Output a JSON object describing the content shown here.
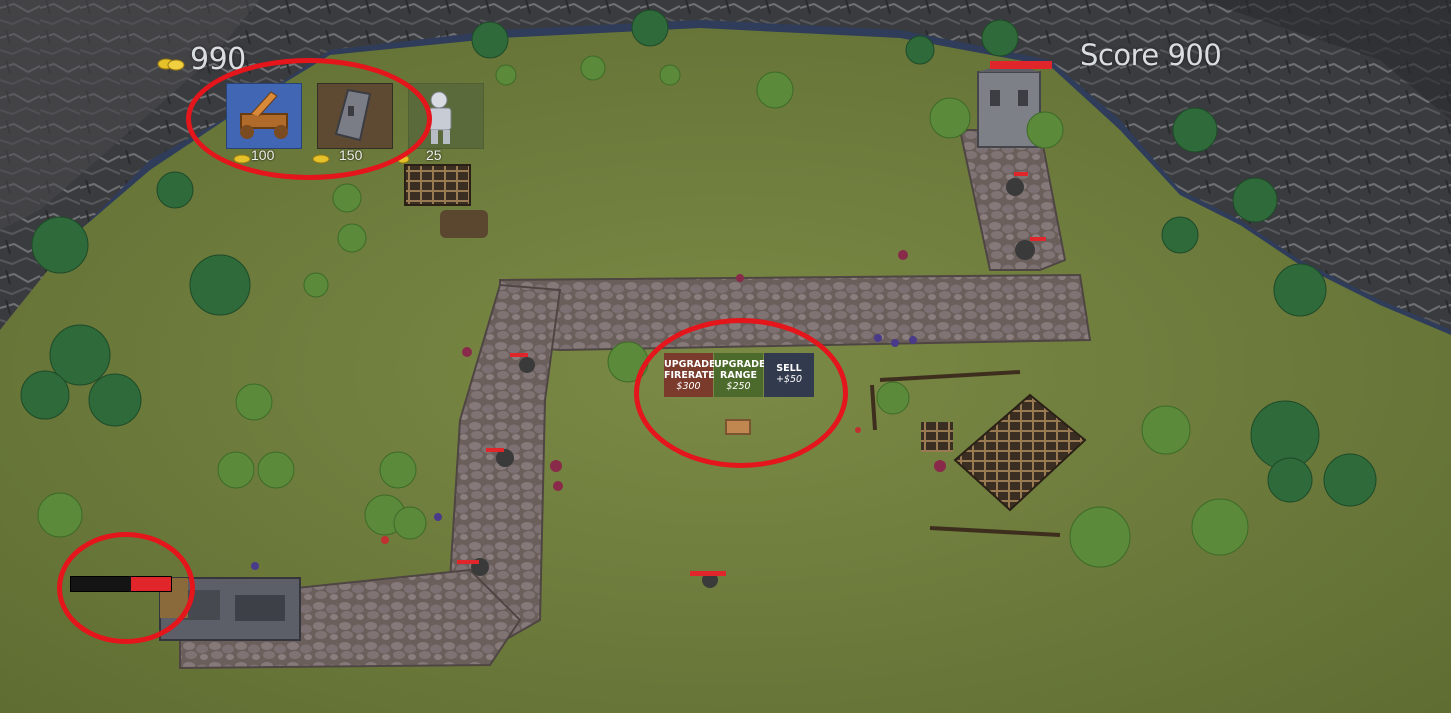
{
  "hud": {
    "gold": "990",
    "score": "Score 900"
  },
  "shop": {
    "items": [
      {
        "name": "catapult-tower",
        "price": "100"
      },
      {
        "name": "stone-tower",
        "price": "150"
      },
      {
        "name": "knight-unit",
        "price": "25"
      }
    ]
  },
  "tower_menu": {
    "upgrade_firerate": {
      "label": "UPGRADE FIRERATE",
      "price": "$300"
    },
    "upgrade_range": {
      "label": "UPGRADE RANGE",
      "price": "$250"
    },
    "sell": {
      "label": "SELL",
      "price": "+$50"
    }
  },
  "base": {
    "health_fraction": 0.4
  },
  "colors": {
    "grass": "#6e7e3c",
    "path": "#6f6360",
    "rock": "#3b3c3e",
    "annotation": "#e4151b",
    "health": "#e0262a",
    "gold": "#e6c22a"
  }
}
